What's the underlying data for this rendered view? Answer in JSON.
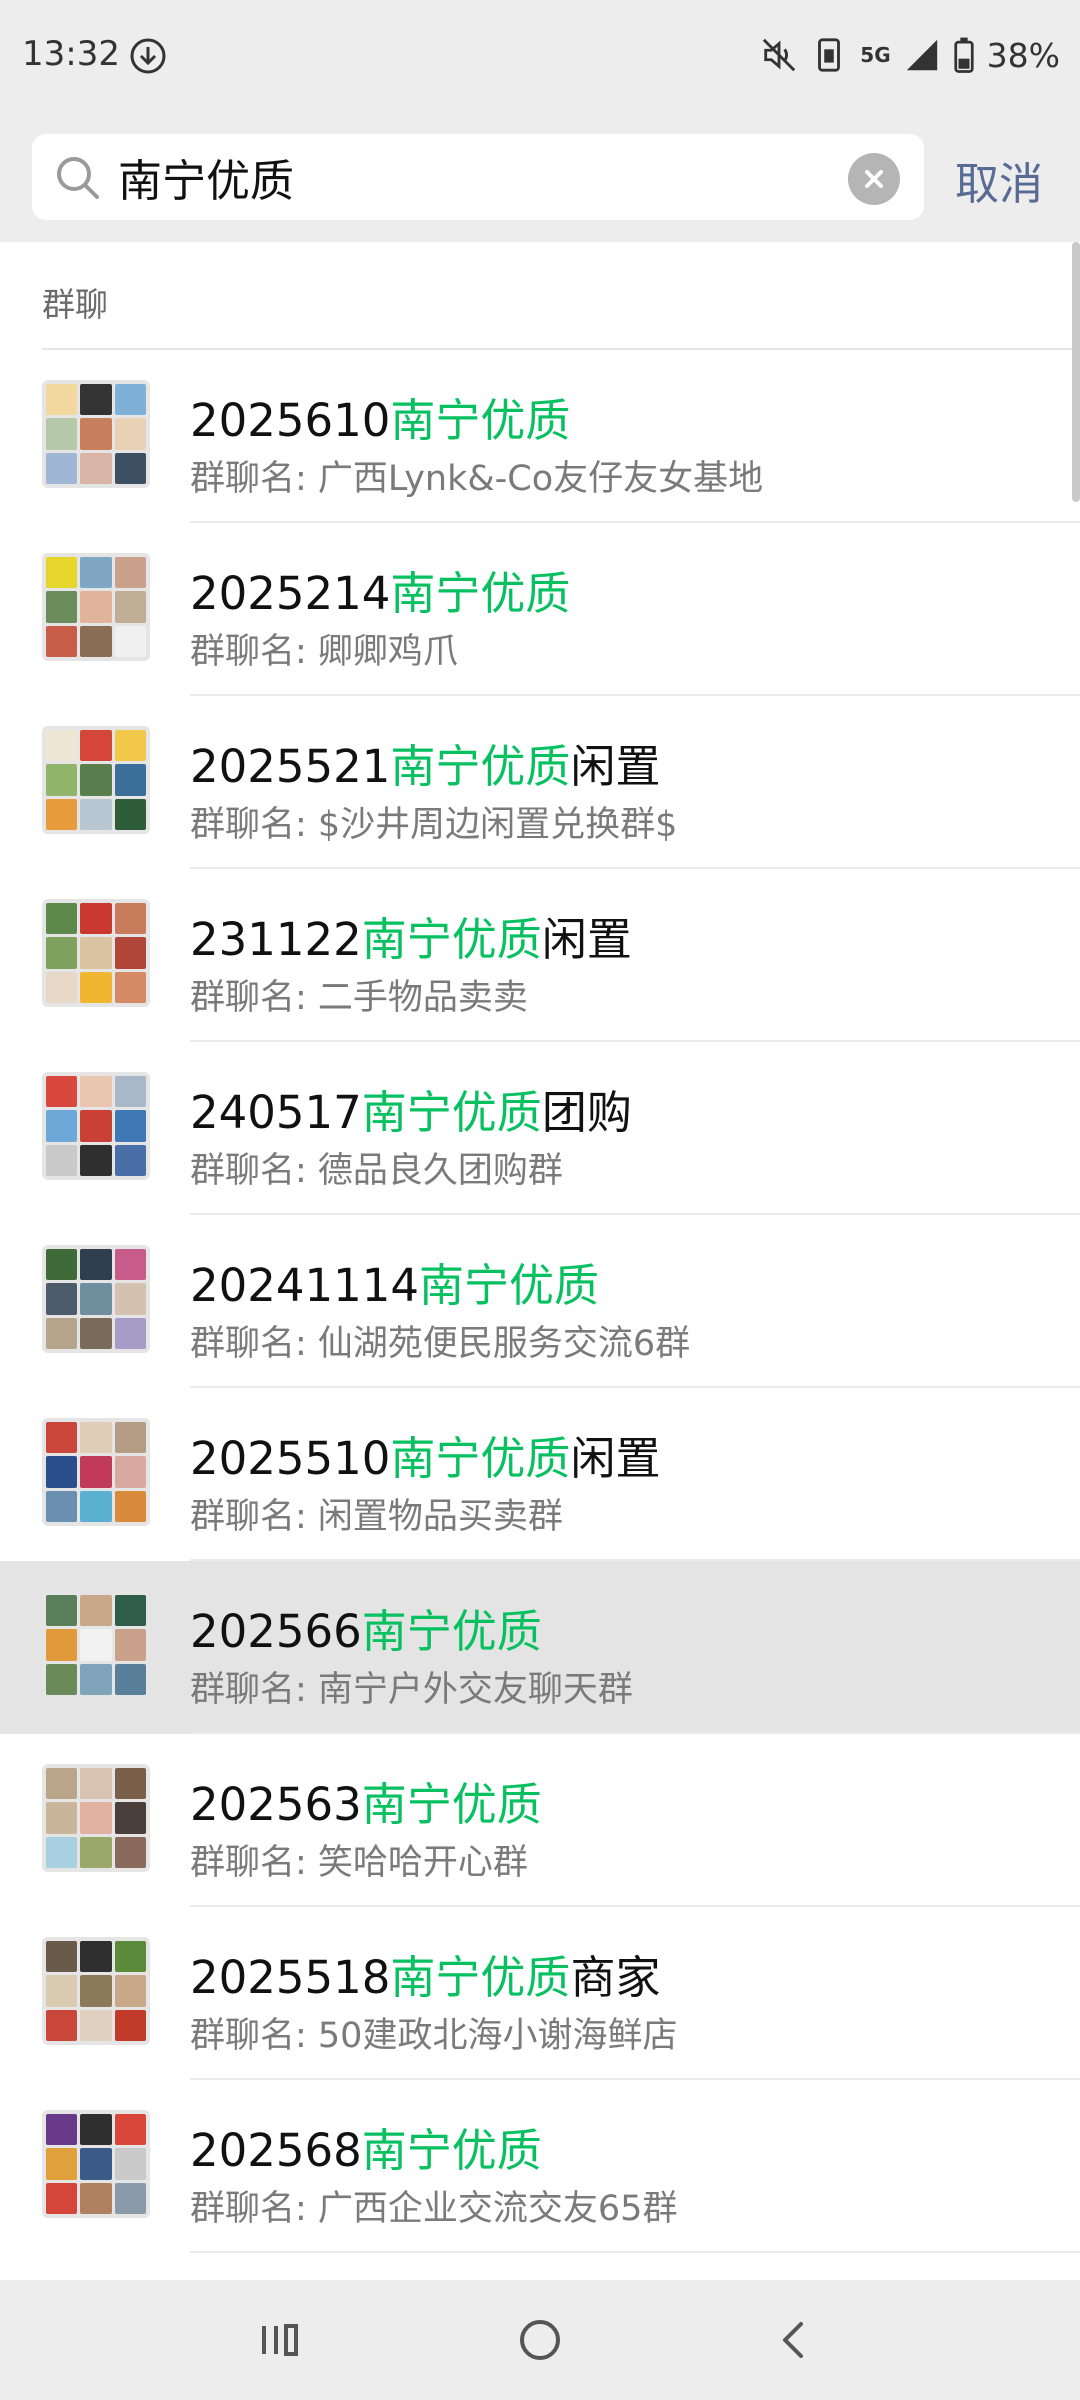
{
  "status_bar": {
    "time": "13:32",
    "battery_percent": "38%",
    "network": "5G"
  },
  "search": {
    "query": "南宁优质",
    "cancel_label": "取消"
  },
  "section": {
    "title": "群聊"
  },
  "results": [
    {
      "prefix": "2025610",
      "highlight": "南宁优质",
      "suffix": "",
      "subtitle": "群聊名: 广西Lynk&-Co友仔友女基地",
      "colors": [
        "#f3d9a0",
        "#333333",
        "#7fb0d8",
        "#b5c9a8",
        "#c77f5e",
        "#e8d1b5",
        "#9fb7d4",
        "#d8b3a6",
        "#3d4f63"
      ]
    },
    {
      "prefix": "2025214",
      "highlight": "南宁优质",
      "suffix": "",
      "subtitle": "群聊名: 卿卿鸡爪",
      "colors": [
        "#e6d52b",
        "#7fa6c3",
        "#c9a08a",
        "#6a8c5a",
        "#e0b49a",
        "#bfae95",
        "#c85d4a",
        "#8a6d55",
        "#f0f0f0"
      ]
    },
    {
      "prefix": "2025521",
      "highlight": "南宁优质",
      "suffix": "闲置",
      "subtitle": "群聊名: $沙井周边闲置兑换群$",
      "colors": [
        "#efe7d5",
        "#d4463a",
        "#f2c84b",
        "#8fb56a",
        "#5a7d4e",
        "#3c6e9a",
        "#e89b3a",
        "#b7c6d1",
        "#2f5d3a"
      ]
    },
    {
      "prefix": "231122",
      "highlight": "南宁优质",
      "suffix": "闲置",
      "subtitle": "群聊名: 二手物品卖卖",
      "colors": [
        "#5d8a4b",
        "#c9392f",
        "#c97c5b",
        "#7ea25e",
        "#d9c3a0",
        "#b04637",
        "#e6d9c8",
        "#f1b631",
        "#d48a65"
      ]
    },
    {
      "prefix": "240517",
      "highlight": "南宁优质",
      "suffix": "团购",
      "subtitle": "群聊名: 德品良久团购群",
      "colors": [
        "#d9483e",
        "#e8c6b0",
        "#a9b8c9",
        "#6da8d8",
        "#c94037",
        "#3f78b5",
        "#c9c9c9",
        "#2f2f2f",
        "#4a6ea8"
      ]
    },
    {
      "prefix": "20241114",
      "highlight": "南宁优质",
      "suffix": "",
      "subtitle": "群聊名: 仙湖苑便民服务交流6群",
      "colors": [
        "#3f6a3a",
        "#2f3e4d",
        "#c75b8a",
        "#4d5c6b",
        "#6f8f9e",
        "#d3c2b0",
        "#b7a48c",
        "#7a6a5a",
        "#a69ac6"
      ]
    },
    {
      "prefix": "2025510",
      "highlight": "南宁优质",
      "suffix": "闲置",
      "subtitle": "群聊名: 闲置物品买卖群",
      "colors": [
        "#c9463a",
        "#e0cdb5",
        "#b59c84",
        "#2a4f8a",
        "#c23a5a",
        "#d9a9a0",
        "#6a8fb0",
        "#5ab0d0",
        "#d98a3a"
      ]
    },
    {
      "prefix": "202566",
      "highlight": "南宁优质",
      "suffix": "",
      "subtitle": "群聊名: 南宁户外交友聊天群",
      "colors": [
        "#5a7d5a",
        "#c9a88a",
        "#2f5d4a",
        "#e09a3a",
        "#f2f2f2",
        "#c9a08a",
        "#6a8a5a",
        "#7fa3b8",
        "#5a7f9a"
      ]
    },
    {
      "prefix": "202563",
      "highlight": "南宁优质",
      "suffix": "",
      "subtitle": "群聊名: 笑哈哈开心群",
      "colors": [
        "#b8a58a",
        "#d9c3b0",
        "#7a5f4a",
        "#c9b59a",
        "#e0b0a0",
        "#4a3f3a",
        "#a8d0e0",
        "#9aa86a",
        "#8a6a5a"
      ]
    },
    {
      "prefix": "2025518",
      "highlight": "南宁优质",
      "suffix": "商家",
      "subtitle": "群聊名: 50建政北海小谢海鲜店",
      "colors": [
        "#6a5a4a",
        "#2f2f2f",
        "#5a8a3a",
        "#d9cbb0",
        "#8a7a5a",
        "#c9a88a",
        "#c9463a",
        "#e0d0c0",
        "#c23a2a"
      ]
    },
    {
      "prefix": "202568",
      "highlight": "南宁优质",
      "suffix": "",
      "subtitle": "群聊名: 广西企业交流交友65群",
      "colors": [
        "#6a3a8a",
        "#2f2f2f",
        "#d9463a",
        "#e0a03a",
        "#3a5a8a",
        "#c9c9c9",
        "#d4463a",
        "#b08060",
        "#8a9aa8"
      ]
    }
  ],
  "highlighted_row_index": 7
}
